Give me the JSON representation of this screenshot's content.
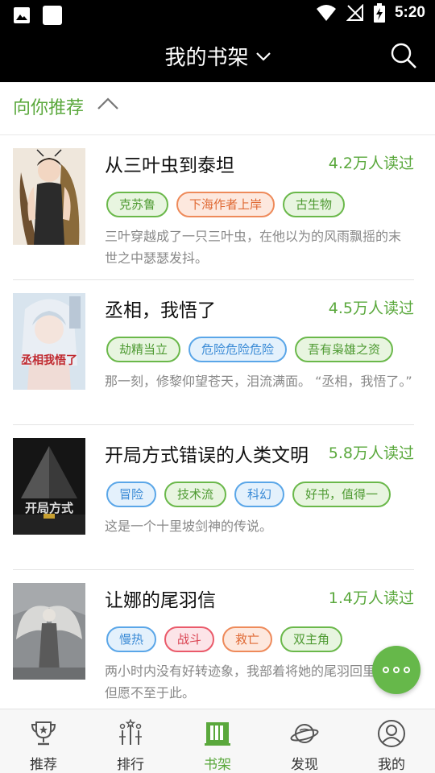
{
  "status_bar": {
    "time": "5:20"
  },
  "header": {
    "title": "我的书架"
  },
  "recommend": {
    "title": "向你推荐"
  },
  "books": [
    {
      "title": "从三叶虫到泰坦",
      "reads": "4.2万人读过",
      "tags": [
        {
          "label": "克苏鲁",
          "color": "green"
        },
        {
          "label": "下海作者上岸",
          "color": "orange"
        },
        {
          "label": "古生物",
          "color": "green"
        }
      ],
      "description": "三叶穿越成了一只三叶虫，在他以为的风雨飘摇的末世之中瑟瑟发抖。"
    },
    {
      "title": "丞相，我悟了",
      "reads": "4.5万人读过",
      "cover_text": "丞相我悟了",
      "tags": [
        {
          "label": "劫精当立",
          "color": "green"
        },
        {
          "label": "危险危险危险",
          "color": "blue"
        },
        {
          "label": "吾有枭雄之资",
          "color": "green"
        }
      ],
      "description": " 那一刻，修黎仰望苍天，泪流满面。 “丞相，我悟了。”"
    },
    {
      "title": "开局方式错误的人类文明",
      "reads": "5.8万人读过",
      "cover_text": "开局方式",
      "tags": [
        {
          "label": "冒险",
          "color": "blue"
        },
        {
          "label": "技术流",
          "color": "green"
        },
        {
          "label": "科幻",
          "color": "blue"
        },
        {
          "label": "好书，值得一",
          "color": "green"
        }
      ],
      "description": "这是一个十里坡剑神的传说。"
    },
    {
      "title": "让娜的尾羽信",
      "reads": "1.4万人读过",
      "tags": [
        {
          "label": "慢热",
          "color": "blue"
        },
        {
          "label": "战斗",
          "color": "red"
        },
        {
          "label": "救亡",
          "color": "orange"
        },
        {
          "label": "双主角",
          "color": "green"
        }
      ],
      "description": "两小时内没有好转迹象，我部着将她的尾羽回里昂。但愿不至于此。"
    }
  ],
  "nav": [
    {
      "label": "推荐",
      "icon": "trophy-icon",
      "active": false
    },
    {
      "label": "排行",
      "icon": "ranking-icon",
      "active": false
    },
    {
      "label": "书架",
      "icon": "bookshelf-icon",
      "active": true
    },
    {
      "label": "发现",
      "icon": "planet-icon",
      "active": false
    },
    {
      "label": "我的",
      "icon": "profile-icon",
      "active": false
    }
  ],
  "colors": {
    "accent": "#5aa83c",
    "fab": "#66b84a",
    "header_bg": "#000000"
  }
}
